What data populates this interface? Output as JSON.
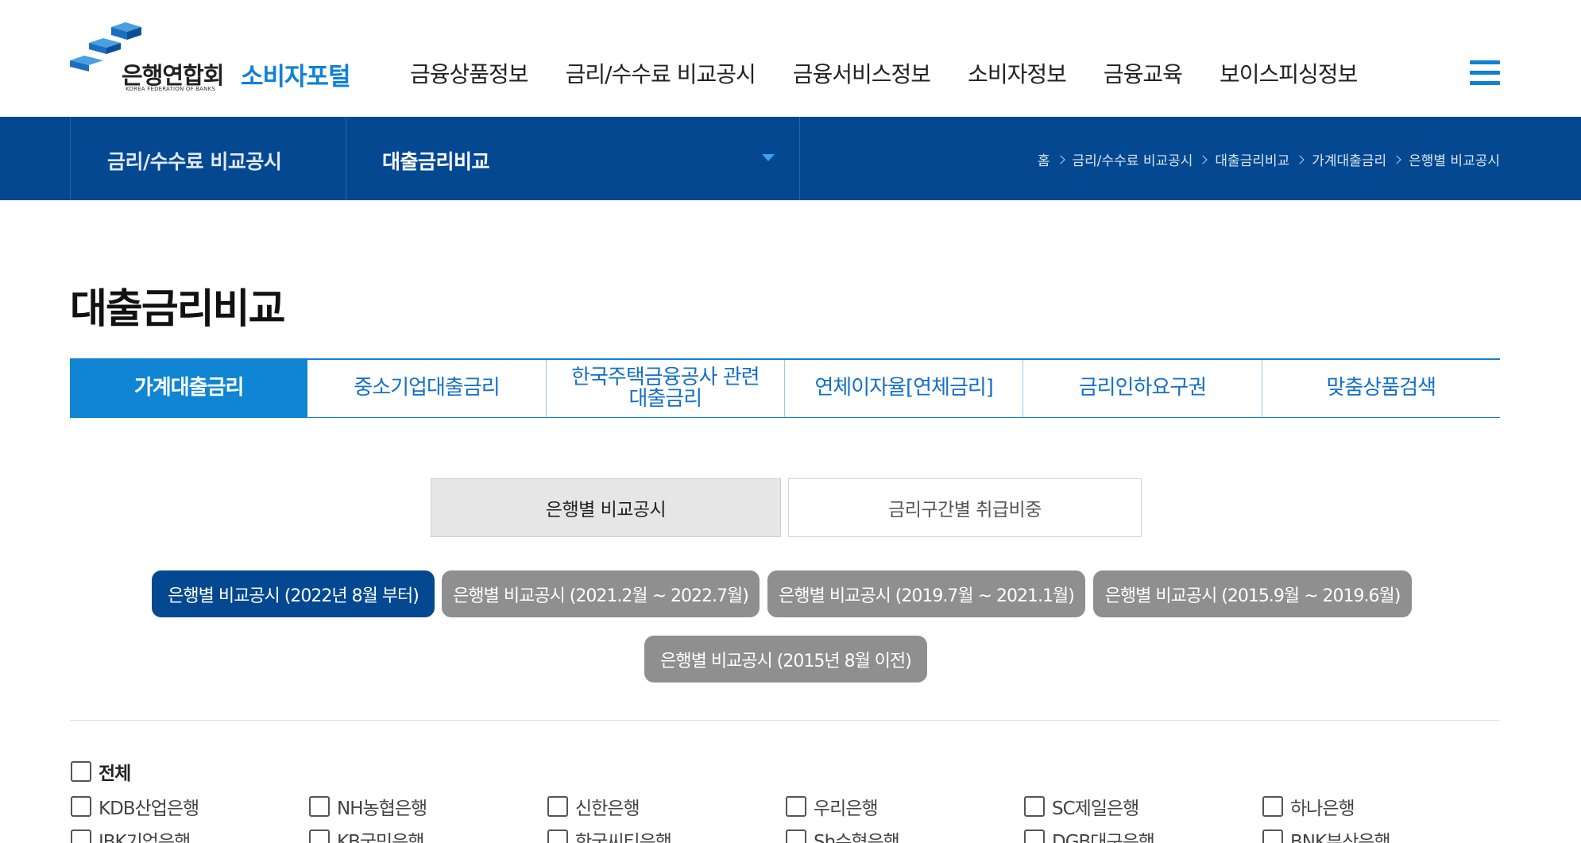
{
  "logo": {
    "name": "은행연합회",
    "sub": "KOREA FEDERATION OF BANKS",
    "portal": "소비자포털"
  },
  "gnb": [
    {
      "label": "금융상품정보"
    },
    {
      "label": "금리/수수료 비교공시"
    },
    {
      "label": "금융서비스정보"
    },
    {
      "label": "소비자정보"
    },
    {
      "label": "금융교육"
    },
    {
      "label": "보이스피싱정보"
    }
  ],
  "subnav": {
    "menu1": "금리/수수료 비교공시",
    "menu2": "대출금리비교",
    "breadcrumb": {
      "home": "홈",
      "items": [
        "금리/수수료 비교공시",
        "대출금리비교",
        "가계대출금리",
        "은행별 비교공시"
      ]
    }
  },
  "page_title": "대출금리비교",
  "tabs": [
    {
      "label": "가계대출금리",
      "active": true
    },
    {
      "label": "중소기업대출금리",
      "active": false
    },
    {
      "label": "한국주택금융공사 관련\n대출금리",
      "active": false
    },
    {
      "label": "연체이자율[연체금리]",
      "active": false
    },
    {
      "label": "금리인하요구권",
      "active": false
    },
    {
      "label": "맞춤상품검색",
      "active": false
    }
  ],
  "segments": {
    "active": "은행별 비교공시",
    "inactive": "금리구간별 취급비중"
  },
  "periods": [
    "은행별 비교공시 (2022년 8월 부터)",
    "은행별 비교공시 (2021.2월 ~ 2022.7월)",
    "은행별 비교공시 (2019.7월 ~ 2021.1월)",
    "은행별 비교공시 (2015.9월 ~ 2019.6월)",
    "은행별 비교공시 (2015년 8월 이전)"
  ],
  "banks": {
    "all_label": "전체",
    "items": [
      "KDB산업은행",
      "NH농협은행",
      "신한은행",
      "우리은행",
      "SC제일은행",
      "하나은행",
      "IBK기업은행",
      "KB국민은행",
      "한국씨티은행",
      "Sh수협은행",
      "DGB대구은행",
      "BNK부산은행"
    ]
  },
  "colors": {
    "brand_navy": "#034891",
    "brand_blue": "#1081d4",
    "pill_inactive": "#8f8f8f"
  }
}
